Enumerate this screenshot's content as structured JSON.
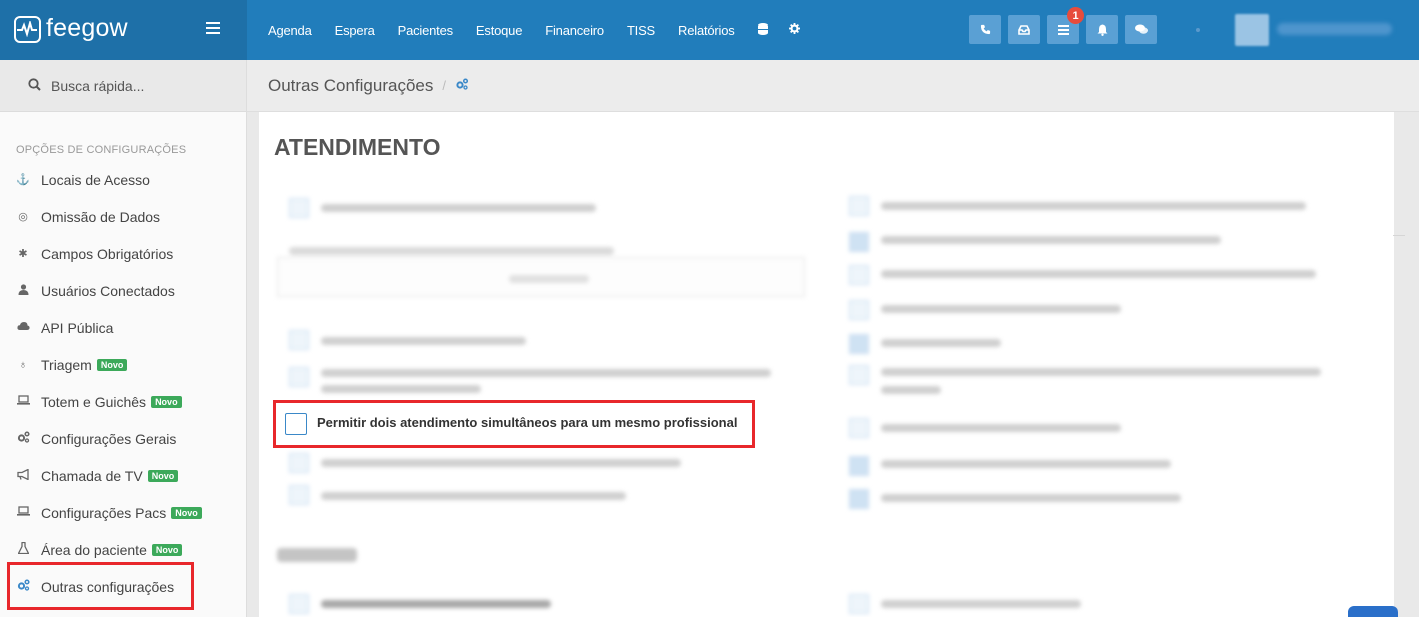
{
  "app": {
    "logo_text": "feegow"
  },
  "topnav": {
    "items": [
      "Agenda",
      "Espera",
      "Pacientes",
      "Estoque",
      "Financeiro",
      "TISS",
      "Relatórios"
    ],
    "extra_icons": [
      "database-icon",
      "gear-icon"
    ]
  },
  "toolbar": {
    "buttons": [
      "phone-icon",
      "inbox-icon",
      "list-icon",
      "bell-icon",
      "chat-icon"
    ],
    "badge_count": "1"
  },
  "search": {
    "label": "Busca rápida..."
  },
  "sidebar": {
    "header": "OPÇÕES DE CONFIGURAÇÕES",
    "novo_label": "Novo",
    "items": [
      {
        "label": "Locais de Acesso",
        "icon": "location-icon",
        "novo": false
      },
      {
        "label": "Omissão de Dados",
        "icon": "eye-slash-icon",
        "novo": false
      },
      {
        "label": "Campos Obrigatórios",
        "icon": "asterisk-icon",
        "novo": false
      },
      {
        "label": "Usuários Conectados",
        "icon": "user-icon",
        "novo": false
      },
      {
        "label": "API Pública",
        "icon": "cloud-icon",
        "novo": false
      },
      {
        "label": "Triagem",
        "icon": "stethoscope-icon",
        "novo": true
      },
      {
        "label": "Totem e Guichês",
        "icon": "laptop-icon",
        "novo": true
      },
      {
        "label": "Configurações Gerais",
        "icon": "cogs-icon",
        "novo": false
      },
      {
        "label": "Chamada de TV",
        "icon": "bullhorn-icon",
        "novo": true
      },
      {
        "label": "Configurações Pacs",
        "icon": "laptop-icon",
        "novo": true
      },
      {
        "label": "Área do paciente",
        "icon": "flask-icon",
        "novo": true
      },
      {
        "label": "Outras configurações",
        "icon": "cogs-icon",
        "novo": false,
        "active": true
      }
    ]
  },
  "breadcrumb": {
    "title": "Outras Configurações",
    "separator": "/"
  },
  "main": {
    "section_title": "ATENDIMENTO",
    "highlighted_option": {
      "label": "Permitir dois atendimento simultâneos para um mesmo profissional",
      "checked": false
    }
  },
  "colors": {
    "topbar": "#217dbb",
    "accent": "#3a88c8",
    "highlight": "#e8272b",
    "novo": "#3ca95a"
  }
}
